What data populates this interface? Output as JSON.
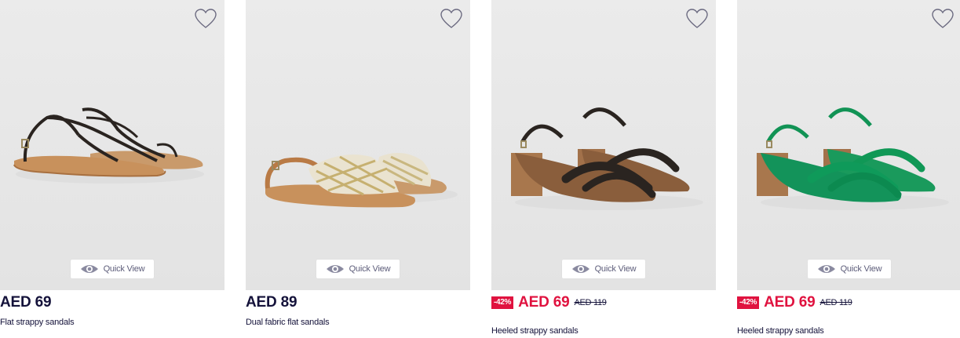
{
  "quick_view_label": "Quick View",
  "colors": {
    "price_text": "#14123a",
    "sale_red": "#e0123f",
    "image_bg": "#e7e7e7"
  },
  "products": [
    {
      "price": "AED 69",
      "name": "Flat strappy sandals",
      "discount": "",
      "old_price": "",
      "image": "black-braided-flat-sandals",
      "wishlist_icon": "heart-outline-icon"
    },
    {
      "price": "AED 89",
      "name": "Dual fabric flat sandals",
      "discount": "",
      "old_price": "",
      "image": "woven-cross-strap-flat-sandals",
      "wishlist_icon": "heart-outline-icon"
    },
    {
      "price": "AED 69",
      "name": "Heeled strappy sandals",
      "discount": "-42%",
      "old_price": "AED 119",
      "image": "black-block-heel-sandals",
      "wishlist_icon": "heart-outline-icon"
    },
    {
      "price": "AED 69",
      "name": "Heeled strappy sandals",
      "discount": "-42%",
      "old_price": "AED 119",
      "image": "green-block-heel-sandals",
      "wishlist_icon": "heart-outline-icon"
    }
  ]
}
